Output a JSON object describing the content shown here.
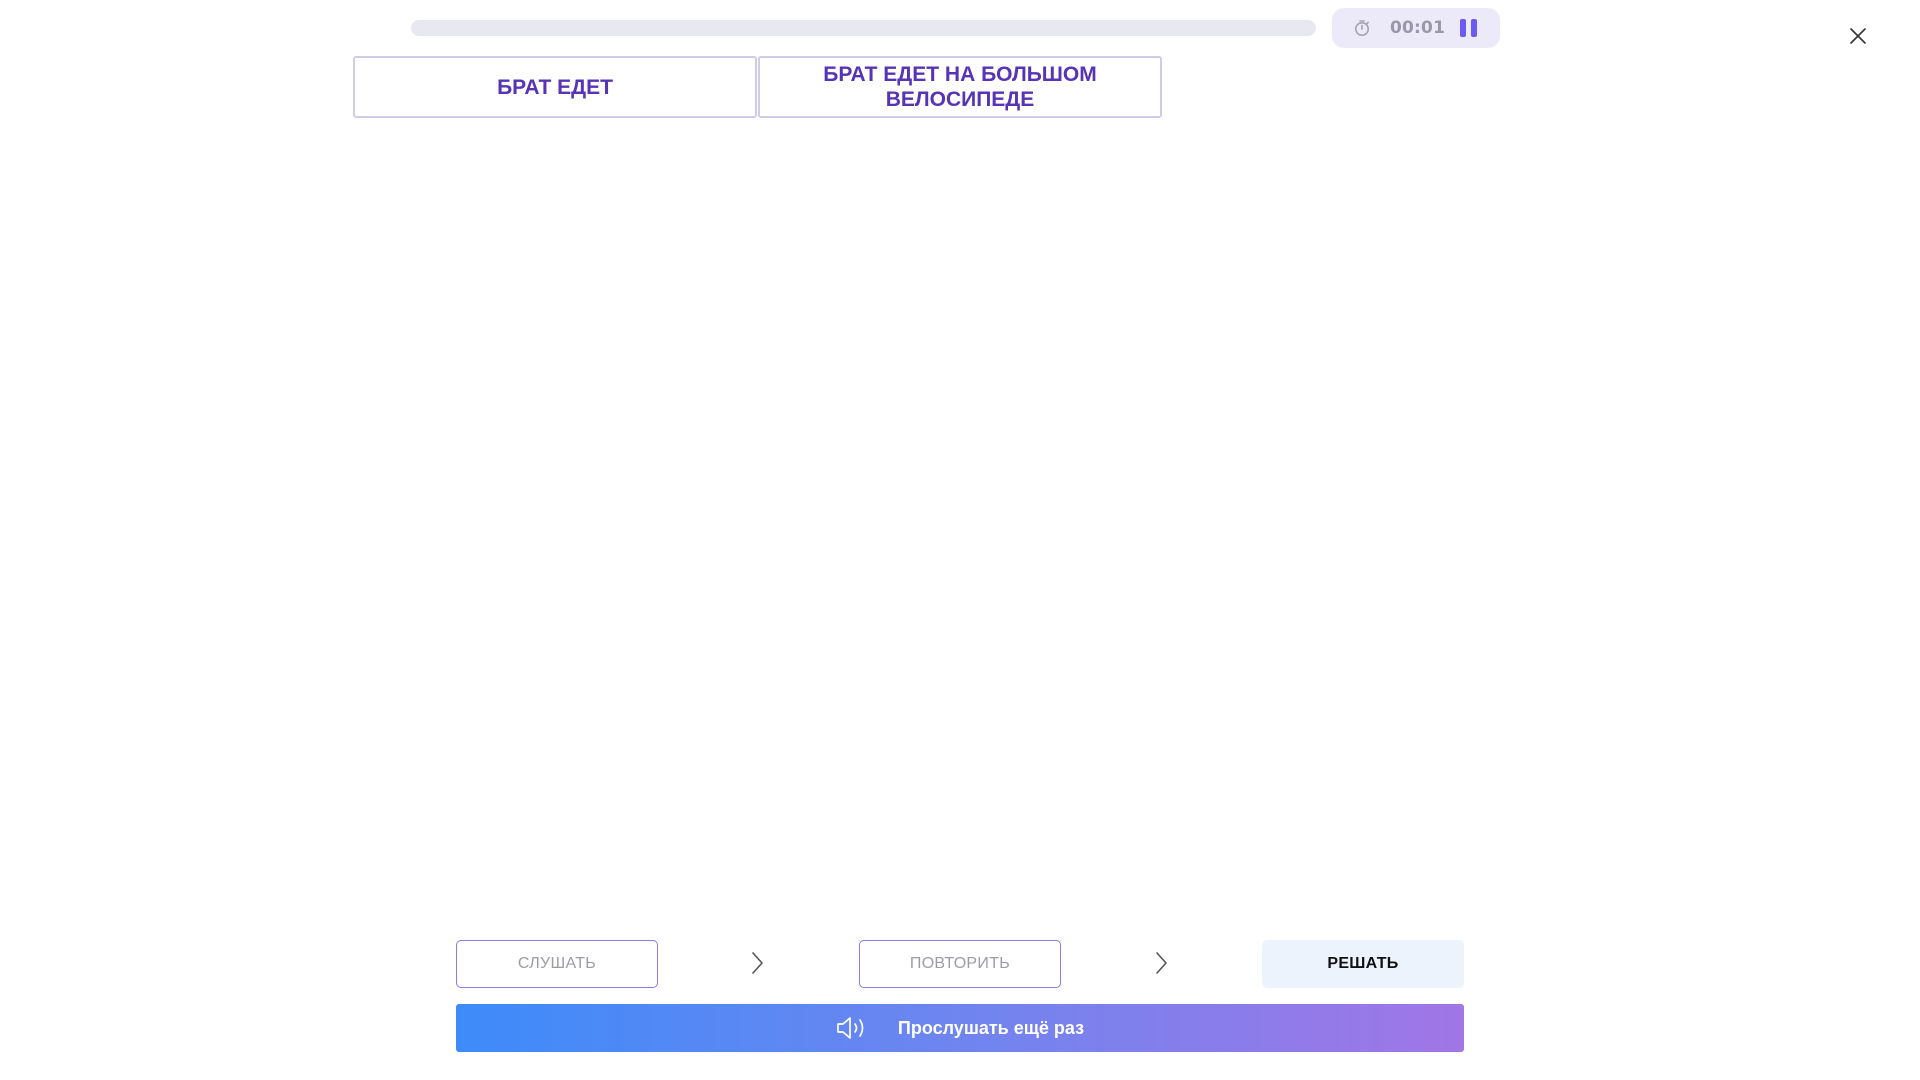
{
  "top_bar": {
    "progress": 0,
    "timer": "00:01",
    "icons": {
      "stopwatch": "stopwatch-icon",
      "pause": "pause-icon",
      "close": "close-icon"
    }
  },
  "cards": [
    {
      "label": "БРАТ ЕДЕТ"
    },
    {
      "label": "БРАТ ЕДЕТ НА БОЛЬШОМ ВЕЛОСИПЕДЕ"
    }
  ],
  "steps": [
    {
      "label": "СЛУШАТЬ"
    },
    {
      "label": "ПОВТОРИТЬ"
    },
    {
      "label": "РЕШАТЬ"
    }
  ],
  "listen_again": {
    "label": "Прослушать ещё раз",
    "icon": "speaker-icon"
  },
  "colors": {
    "accent": "#6a5cf0",
    "card_text": "#5733b6",
    "gradient_start": "#3d8bfa",
    "gradient_end": "#a176e6"
  }
}
